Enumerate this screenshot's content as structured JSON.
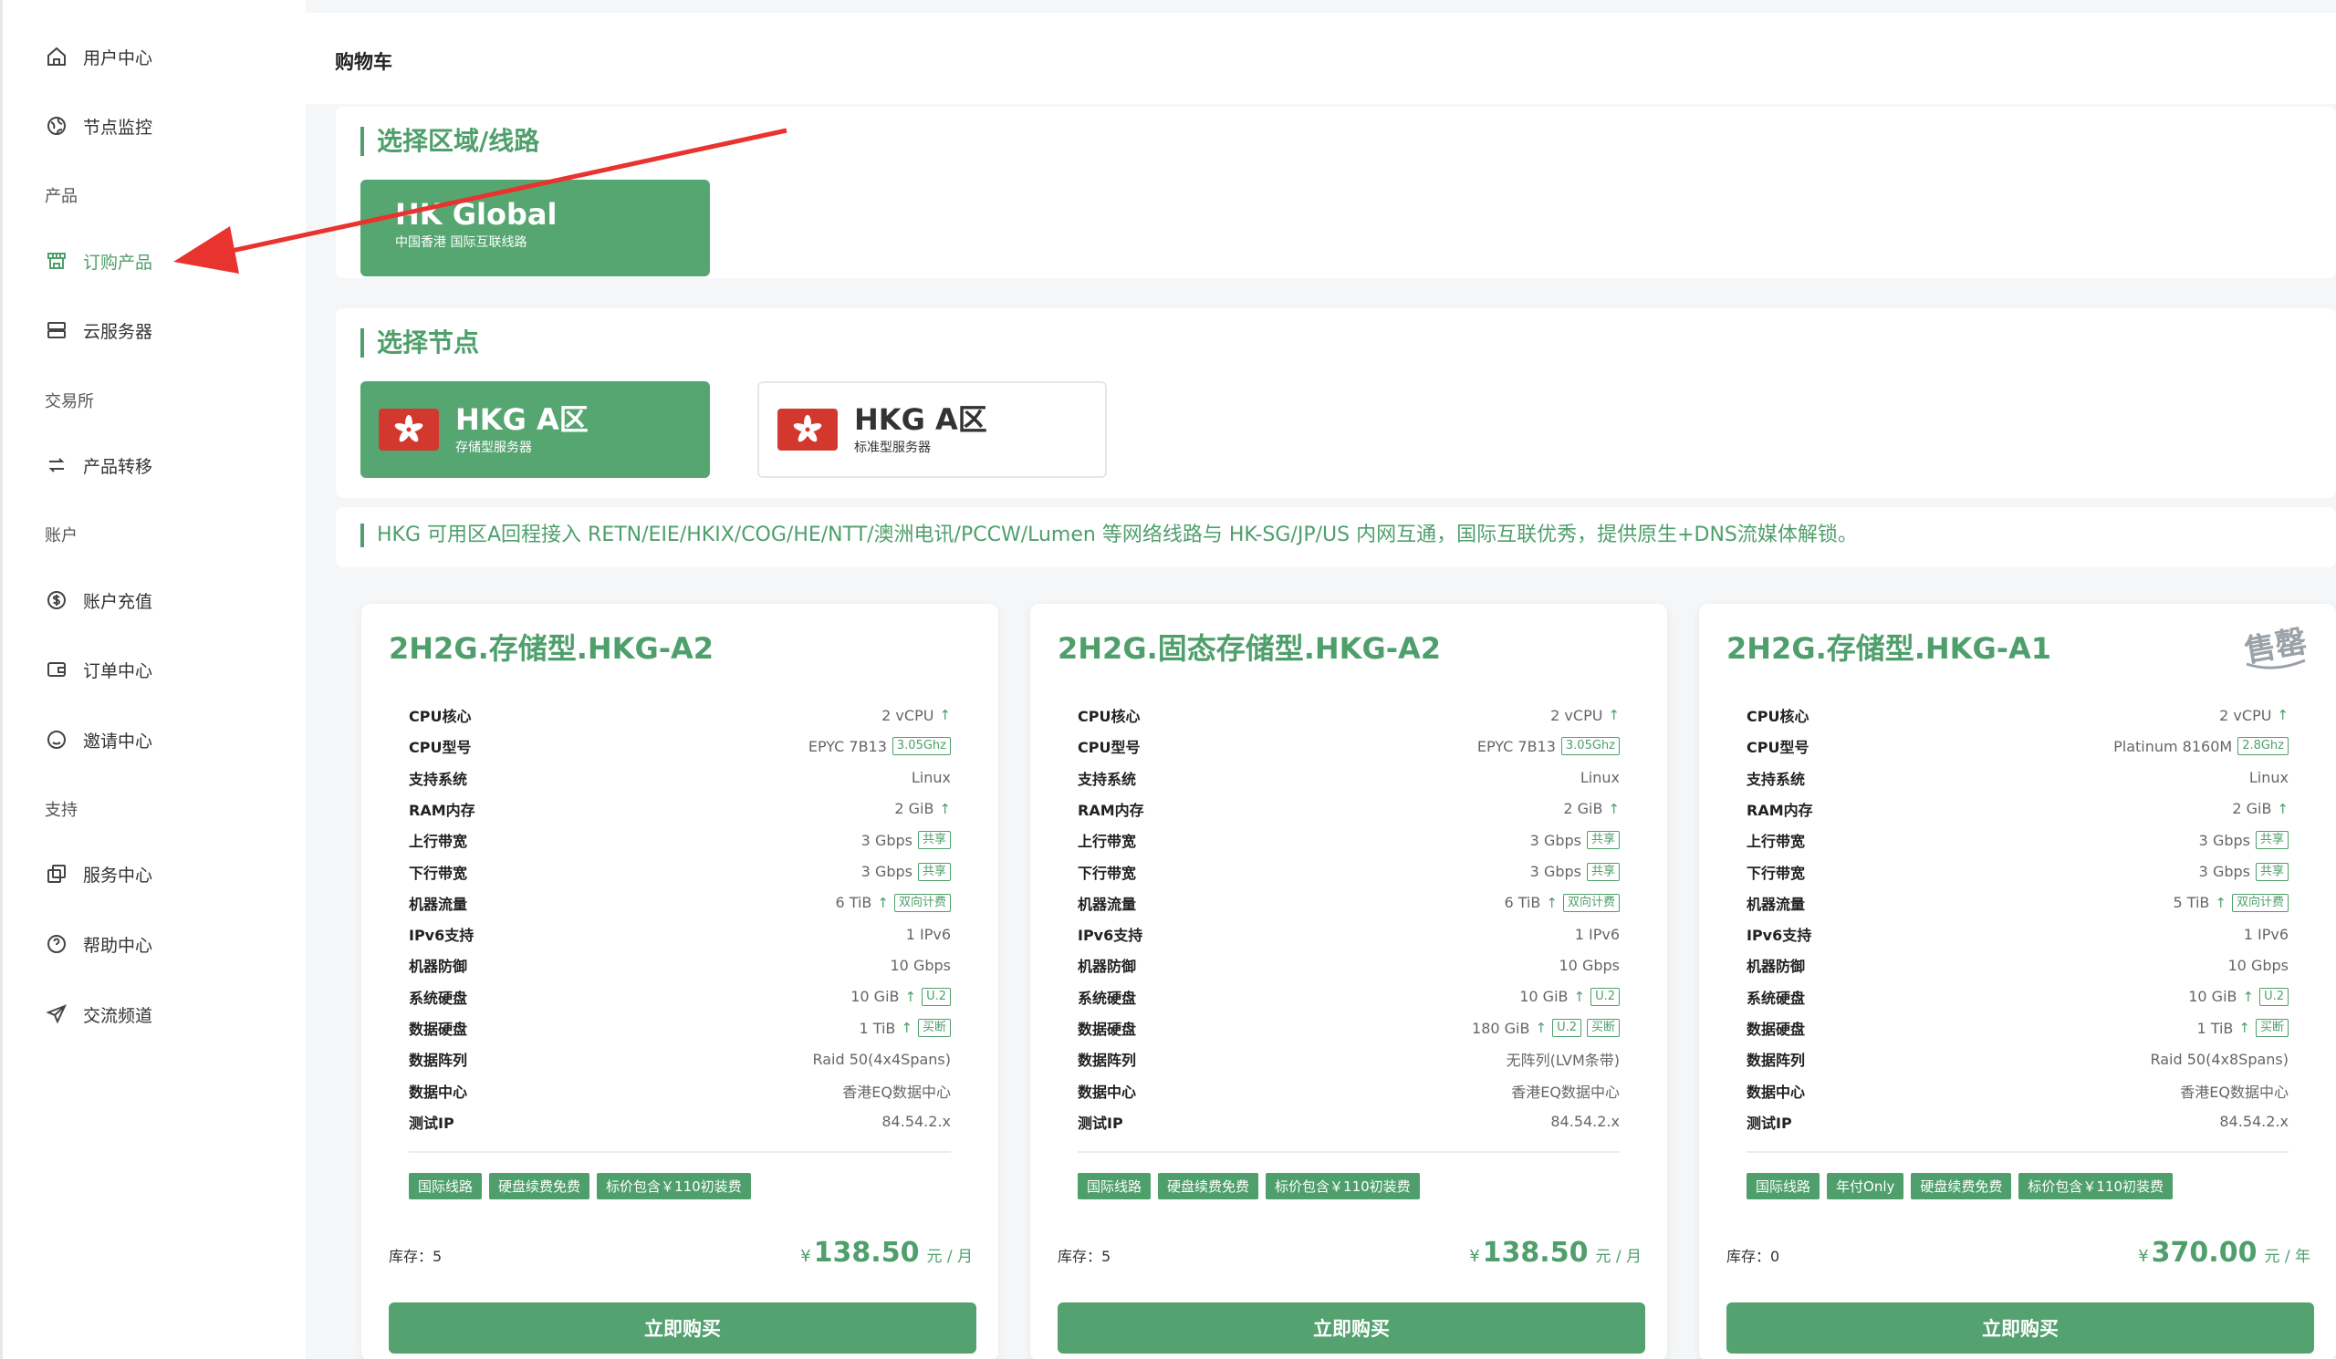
{
  "sidebar": {
    "items": {
      "user_center": "用户中心",
      "node_monitor": "节点监控",
      "group_product": "产品",
      "order_product": "订购产品",
      "cloud_server": "云服务器",
      "group_exchange": "交易所",
      "product_transfer": "产品转移",
      "group_account": "账户",
      "account_recharge": "账户充值",
      "order_center": "订单中心",
      "invite_center": "邀请中心",
      "group_support": "支持",
      "service_center": "服务中心",
      "help_center": "帮助中心",
      "community": "交流频道"
    },
    "accent": "#4e9f6b"
  },
  "header": {
    "title": "购物车"
  },
  "region": {
    "title": "选择区域/线路",
    "card_title": "HK Global",
    "card_sub": "中国香港 国际互联线路"
  },
  "node": {
    "title": "选择节点",
    "options": [
      {
        "title": "HKG A区",
        "sub": "存储型服务器"
      },
      {
        "title": "HKG A区",
        "sub": "标准型服务器"
      }
    ]
  },
  "description": "HKG 可用区A回程接入 RETN/EIE/HKIX/COG/HE/NTT/澳洲电讯/PCCW/Lumen 等网络线路与 HK-SG/JP/US 内网互通，国际互联优秀，提供原生+DNS流媒体解锁。",
  "spec_labels": [
    "CPU核心",
    "CPU型号",
    "支持系统",
    "RAM内存",
    "上行带宽",
    "下行带宽",
    "机器流量",
    "IPv6支持",
    "机器防御",
    "系统硬盘",
    "数据硬盘",
    "数据阵列",
    "数据中心",
    "测试IP"
  ],
  "products": [
    {
      "name": "2H2G.存储型.HKG-A2",
      "specs": [
        {
          "value": "2 vCPU",
          "up": true
        },
        {
          "value": "EPYC 7B13",
          "tags": [
            "3.05Ghz"
          ]
        },
        {
          "value": "Linux"
        },
        {
          "value": "2 GiB",
          "up": true
        },
        {
          "value": "3 Gbps",
          "tags": [
            "共享"
          ]
        },
        {
          "value": "3 Gbps",
          "tags": [
            "共享"
          ]
        },
        {
          "value": "6 TiB",
          "up": true,
          "tags": [
            "双向计费"
          ]
        },
        {
          "value": "1 IPv6"
        },
        {
          "value": "10 Gbps"
        },
        {
          "value": "10 GiB",
          "up": true,
          "tags": [
            "U.2"
          ]
        },
        {
          "value": "1 TiB",
          "up": true,
          "tags": [
            "买断"
          ]
        },
        {
          "value": "Raid 50(4x4Spans)"
        },
        {
          "value": "香港EQ数据中心"
        },
        {
          "value": "84.54.2.x"
        }
      ],
      "tags": [
        "国际线路",
        "硬盘续费免费",
        "标价包含￥110初装费"
      ],
      "stock_label": "库存：",
      "stock": "5",
      "currency": "¥",
      "price": "138.50",
      "unit": "元 / 月",
      "buy_label": "立即购买",
      "sold_out": false
    },
    {
      "name": "2H2G.固态存储型.HKG-A2",
      "specs": [
        {
          "value": "2 vCPU",
          "up": true
        },
        {
          "value": "EPYC 7B13",
          "tags": [
            "3.05Ghz"
          ]
        },
        {
          "value": "Linux"
        },
        {
          "value": "2 GiB",
          "up": true
        },
        {
          "value": "3 Gbps",
          "tags": [
            "共享"
          ]
        },
        {
          "value": "3 Gbps",
          "tags": [
            "共享"
          ]
        },
        {
          "value": "6 TiB",
          "up": true,
          "tags": [
            "双向计费"
          ]
        },
        {
          "value": "1 IPv6"
        },
        {
          "value": "10 Gbps"
        },
        {
          "value": "10 GiB",
          "up": true,
          "tags": [
            "U.2"
          ]
        },
        {
          "value": "180 GiB",
          "up": true,
          "tags": [
            "U.2",
            "买断"
          ]
        },
        {
          "value": "无阵列(LVM条带)"
        },
        {
          "value": "香港EQ数据中心"
        },
        {
          "value": "84.54.2.x"
        }
      ],
      "tags": [
        "国际线路",
        "硬盘续费免费",
        "标价包含￥110初装费"
      ],
      "stock_label": "库存：",
      "stock": "5",
      "currency": "¥",
      "price": "138.50",
      "unit": "元 / 月",
      "buy_label": "立即购买",
      "sold_out": false
    },
    {
      "name": "2H2G.存储型.HKG-A1",
      "specs": [
        {
          "value": "2 vCPU",
          "up": true
        },
        {
          "value": "Platinum 8160M",
          "tags": [
            "2.8Ghz"
          ]
        },
        {
          "value": "Linux"
        },
        {
          "value": "2 GiB",
          "up": true
        },
        {
          "value": "3 Gbps",
          "tags": [
            "共享"
          ]
        },
        {
          "value": "3 Gbps",
          "tags": [
            "共享"
          ]
        },
        {
          "value": "5 TiB",
          "up": true,
          "tags": [
            "双向计费"
          ]
        },
        {
          "value": "1 IPv6"
        },
        {
          "value": "10 Gbps"
        },
        {
          "value": "10 GiB",
          "up": true,
          "tags": [
            "U.2"
          ]
        },
        {
          "value": "1 TiB",
          "up": true,
          "tags": [
            "买断"
          ]
        },
        {
          "value": "Raid 50(4x8Spans)"
        },
        {
          "value": "香港EQ数据中心"
        },
        {
          "value": "84.54.2.x"
        }
      ],
      "tags": [
        "国际线路",
        "年付Only",
        "硬盘续费免费",
        "标价包含￥110初装费"
      ],
      "stock_label": "库存：",
      "stock": "0",
      "currency": "¥",
      "price": "370.00",
      "unit": "元 / 年",
      "buy_label": "立即购买",
      "sold_out": true,
      "stamp": "售罄"
    }
  ]
}
